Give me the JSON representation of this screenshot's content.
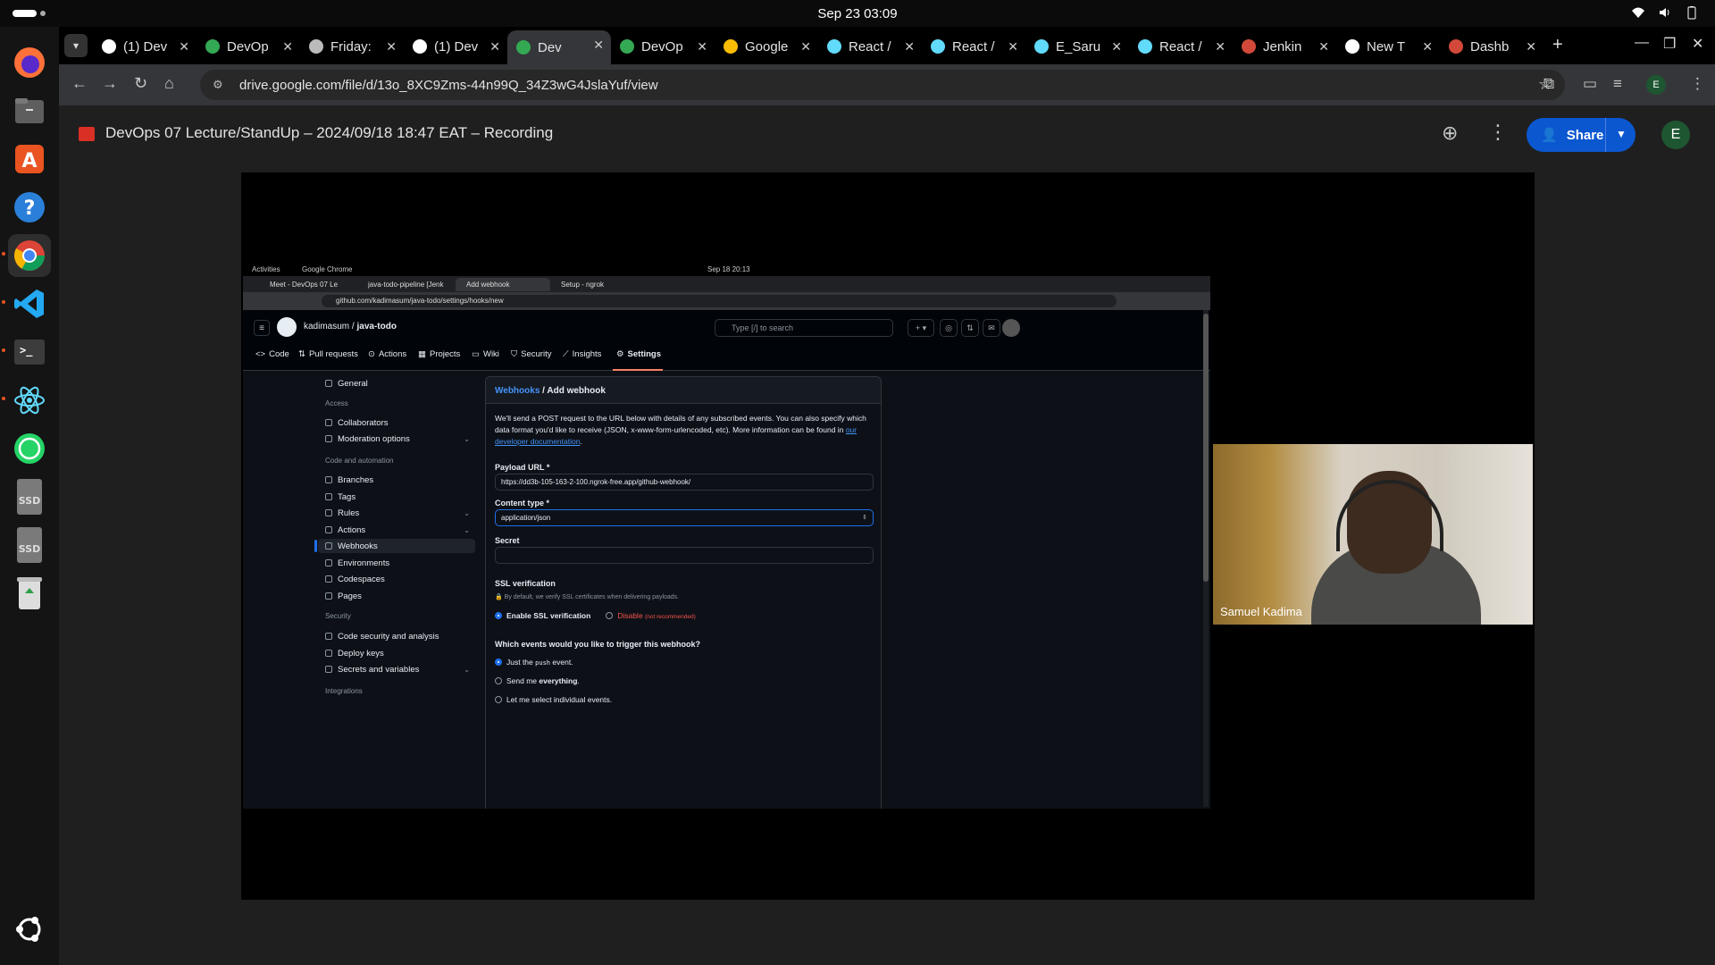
{
  "system": {
    "clock": "Sep 23  03:09"
  },
  "dock": {
    "apps": [
      "firefox-icon",
      "files-icon",
      "app-center-icon",
      "help-icon",
      "chrome-icon",
      "vscode-icon",
      "terminal-icon",
      "react-devtools-icon",
      "whatsapp-icon",
      "ssd-drive-icon",
      "ssd-drive-icon",
      "trash-icon"
    ],
    "disk_label_1": "SSD",
    "disk_label_2": "SSD"
  },
  "tabs": [
    {
      "title": "(1) Dev",
      "fav_color": "#ffffff"
    },
    {
      "title": "DevOp",
      "fav_color": "#34a853"
    },
    {
      "title": "Friday:",
      "fav_color": "#bbbbbb"
    },
    {
      "title": "(1) Dev",
      "fav_color": "#ffffff"
    },
    {
      "title": "Dev",
      "fav_color": "#34a853",
      "active": true
    },
    {
      "title": "DevOp",
      "fav_color": "#34a853"
    },
    {
      "title": "Google",
      "fav_color": "#fbbc04"
    },
    {
      "title": "React /",
      "fav_color": "#61dafb"
    },
    {
      "title": "React /",
      "fav_color": "#61dafb"
    },
    {
      "title": "E_Saru",
      "fav_color": "#61dafb"
    },
    {
      "title": "React /",
      "fav_color": "#61dafb"
    },
    {
      "title": "Jenkin",
      "fav_color": "#d24939"
    },
    {
      "title": "New T",
      "fav_color": "#ffffff"
    },
    {
      "title": "Dashb",
      "fav_color": "#d24939"
    }
  ],
  "omnibox": {
    "url": "drive.google.com/file/d/13o_8XC9Zms-44n99Q_34Z3wG4JslaYuf/view"
  },
  "profile_initial": "E",
  "drive": {
    "title": "DevOps 07 Lecture/StandUp – 2024/09/18 18:47 EAT – Recording",
    "share_label": "Share",
    "account_initial": "E"
  },
  "shared": {
    "topbar": {
      "activities": "Activities",
      "app": "Google Chrome",
      "clock": "Sep 18  20:13"
    },
    "tabs": [
      "Meet - DevOps 07 Le",
      "java-todo-pipeline [Jenk",
      "Add webhook",
      "Setup - ngrok"
    ],
    "url": "github.com/kadimasum/java-todo/settings/hooks/new",
    "repo_owner": "kadimasum",
    "repo_name": "java-todo",
    "search_placeholder": "Type [/] to search",
    "nav": [
      "Code",
      "Pull requests",
      "Actions",
      "Projects",
      "Wiki",
      "Security",
      "Insights",
      "Settings"
    ],
    "sidebar": {
      "general": "General",
      "access_head": "Access",
      "collaborators": "Collaborators",
      "moderation": "Moderation options",
      "code_head": "Code and automation",
      "branches": "Branches",
      "tags": "Tags",
      "rules": "Rules",
      "actions": "Actions",
      "webhooks": "Webhooks",
      "environments": "Environments",
      "codespaces": "Codespaces",
      "pages": "Pages",
      "security_head": "Security",
      "code_security": "Code security and analysis",
      "deploy_keys": "Deploy keys",
      "secrets": "Secrets and variables",
      "integrations_head": "Integrations"
    },
    "form": {
      "crumb_link": "Webhooks",
      "crumb_sep": " / ",
      "crumb_page": "Add webhook",
      "desc_1": "We'll send a POST request to the URL below with details of any subscribed events. You can also specify which data format you'd like to receive (JSON, x-www-form-urlencoded, etc). More information can be found in",
      "desc_link": "our developer documentation",
      "payload_label": "Payload URL *",
      "payload_value": "https://dd3b-105-163-2-100.ngrok-free.app/github-webhook/",
      "content_label": "Content type *",
      "content_value": "application/json",
      "secret_label": "Secret",
      "ssl_label": "SSL verification",
      "ssl_note": "By default, we verify SSL certificates when delivering payloads.",
      "ssl_enable": "Enable SSL verification",
      "ssl_disable": "Disable",
      "ssl_disable_note": "(not recommended)",
      "events_label": "Which events would you like to trigger this webhook?",
      "event_1_pre": "Just the",
      "event_1_code": "push",
      "event_1_post": "event.",
      "event_2_pre": "Send me",
      "event_2_bold": "everything",
      "event_2_post": ".",
      "event_3": "Let me select individual events."
    }
  },
  "participant": {
    "name": "Samuel Kadima"
  }
}
